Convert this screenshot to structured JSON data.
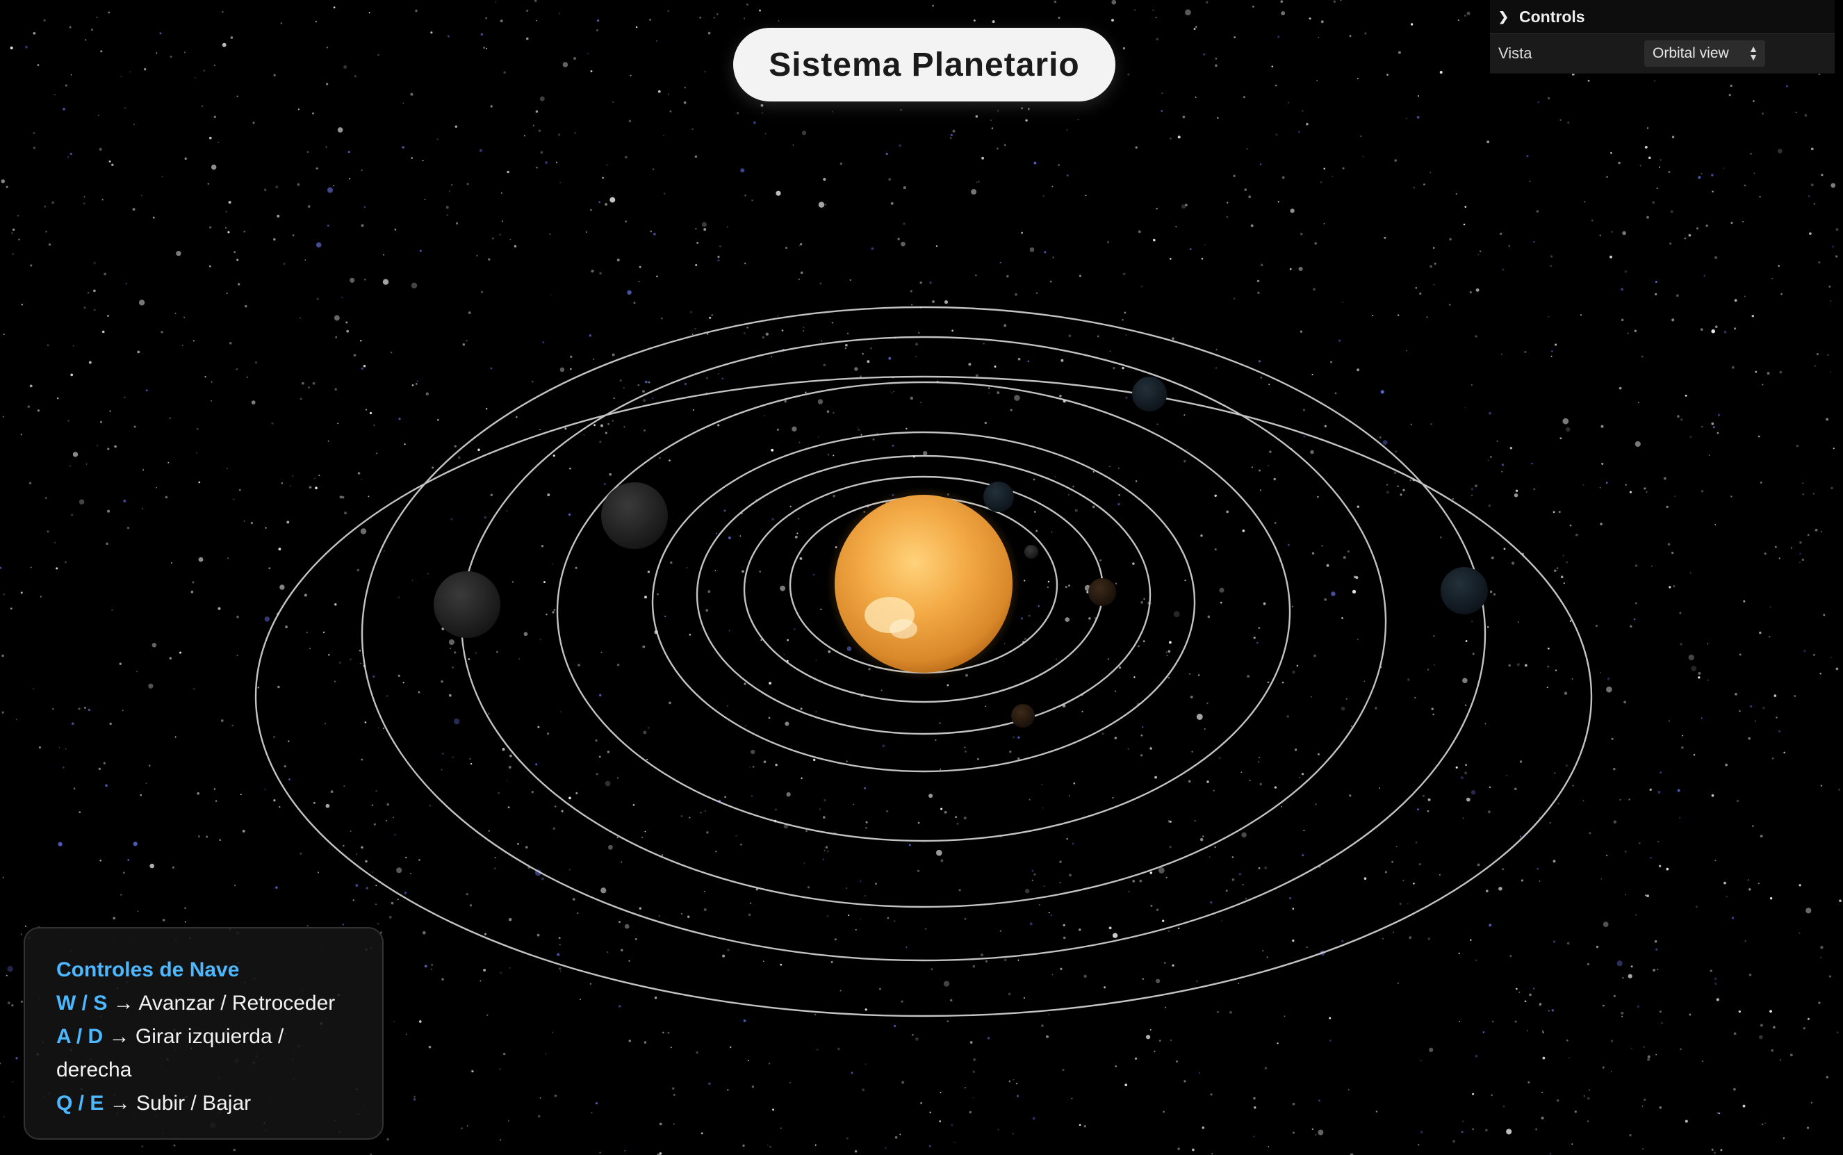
{
  "title": "Sistema Planetario",
  "gui": {
    "header": "Controls",
    "rows": [
      {
        "label": "Vista",
        "value": "Orbital view"
      }
    ]
  },
  "ship_controls": {
    "heading": "Controles de Nave",
    "items": [
      {
        "keys": "W / S",
        "arrow": "→",
        "action": "Avanzar / Retroceder"
      },
      {
        "keys": "A / D",
        "arrow": "→",
        "action": "Girar izquierda / derecha"
      },
      {
        "keys": "Q / E",
        "arrow": "→",
        "action": "Subir / Bajar"
      }
    ]
  },
  "colors": {
    "background": "#000000",
    "orbit": "#d9d9d9",
    "sun": "#f0a040",
    "accent": "#4db8ff"
  },
  "icons": {
    "collapse": "chevron-down-icon",
    "select": "select-arrows-icon"
  }
}
